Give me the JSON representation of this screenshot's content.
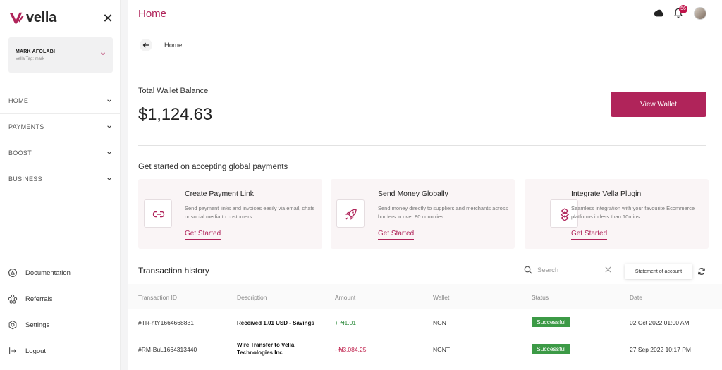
{
  "app": {
    "name": "vella"
  },
  "profile": {
    "name": "MARK AFOLABI",
    "tag": "Vella Tag: mark"
  },
  "nav": [
    {
      "label": "HOME"
    },
    {
      "label": "PAYMENTS"
    },
    {
      "label": "BOOST"
    },
    {
      "label": "BUSINESS"
    }
  ],
  "bottom_nav": [
    {
      "label": "Documentation",
      "icon": "documentation-icon"
    },
    {
      "label": "Referrals",
      "icon": "referrals-icon"
    },
    {
      "label": "Settings",
      "icon": "settings-icon"
    },
    {
      "label": "Logout",
      "icon": "logout-icon"
    }
  ],
  "header": {
    "title": "Home",
    "notifications": "56"
  },
  "breadcrumb": {
    "label": "Home"
  },
  "wallet": {
    "label": "Total Wallet Balance",
    "balance": "$1,124.63",
    "button": "View Wallet"
  },
  "get_started": {
    "title": "Get started on accepting global payments",
    "cards": [
      {
        "title": "Create Payment Link",
        "desc": "Send payment links and invoices easily via email, chats or social media to customers",
        "link": "Get Started",
        "icon": "link-icon"
      },
      {
        "title": "Send Money Globally",
        "desc": "Send money directly to suppliers and merchants across borders in over 80 countries.",
        "link": "Get Started",
        "icon": "rocket-icon"
      },
      {
        "title": "Integrate Vella Plugin",
        "desc": "Seamless integration with your favourite Ecommerce platforms in less than 10mins",
        "link": "Get Started",
        "icon": "layers-icon"
      }
    ]
  },
  "transactions": {
    "title": "Transaction history",
    "search_placeholder": "Search",
    "statement_button": "Statement of account",
    "columns": [
      "Transaction ID",
      "Description",
      "Amount",
      "Wallet",
      "Status",
      "Date"
    ],
    "rows": [
      {
        "id": "#TR-htY1664668831",
        "desc": "Received 1.01 USD - Savings",
        "amount": "+ ₦1.01",
        "wallet": "NGNT",
        "status": "Successful",
        "date": "02 Oct 2022 01:00 AM"
      },
      {
        "id": "#RM-BuL1664313440",
        "desc": "Wire Transfer to Vella Technologies Inc",
        "amount": "- ₦3,084.25",
        "wallet": "NGNT",
        "status": "Successful",
        "date": "27 Sep 2022 10:17 PM"
      }
    ]
  },
  "colors": {
    "brand": "#b0245a",
    "success": "#3c9a46",
    "positive": "#2e8b3d",
    "negative": "#c0234e"
  }
}
